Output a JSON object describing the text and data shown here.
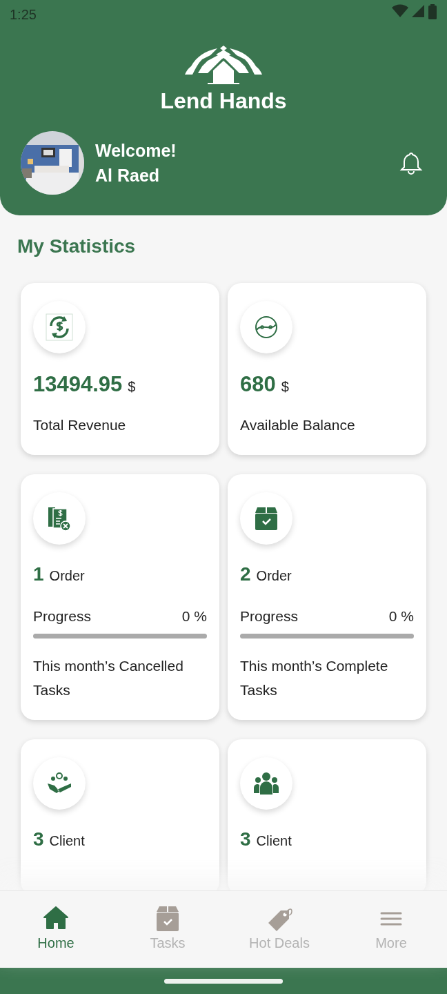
{
  "status_bar": {
    "time": "1:25"
  },
  "header": {
    "app_name": "Lend Hands",
    "greeting": "Welcome!",
    "user_name": "Al Raed"
  },
  "section_title": "My Statistics",
  "cards": [
    {
      "kind": "amount",
      "value": "13494.95",
      "unit": "$",
      "label": "Total Revenue"
    },
    {
      "kind": "amount",
      "value": "680",
      "unit": "$",
      "label": "Available Balance"
    },
    {
      "kind": "order",
      "value": "1",
      "unit": "Order",
      "progress_label": "Progress",
      "reading": "0 %",
      "level": 0,
      "label": "This month’s Cancelled Tasks"
    },
    {
      "kind": "order",
      "value": "2",
      "unit": "Order",
      "progress_label": "Progress",
      "reading": "0 %",
      "level": 0,
      "label": "This month’s Complete Tasks"
    },
    {
      "kind": "client",
      "value": "3",
      "unit": "Client"
    },
    {
      "kind": "client",
      "value": "3",
      "unit": "Client"
    }
  ],
  "nav": [
    {
      "label": "Home",
      "selected": true
    },
    {
      "label": "Tasks",
      "selected": false
    },
    {
      "label": "Hot Deals",
      "selected": false
    },
    {
      "label": "More",
      "selected": false
    }
  ]
}
